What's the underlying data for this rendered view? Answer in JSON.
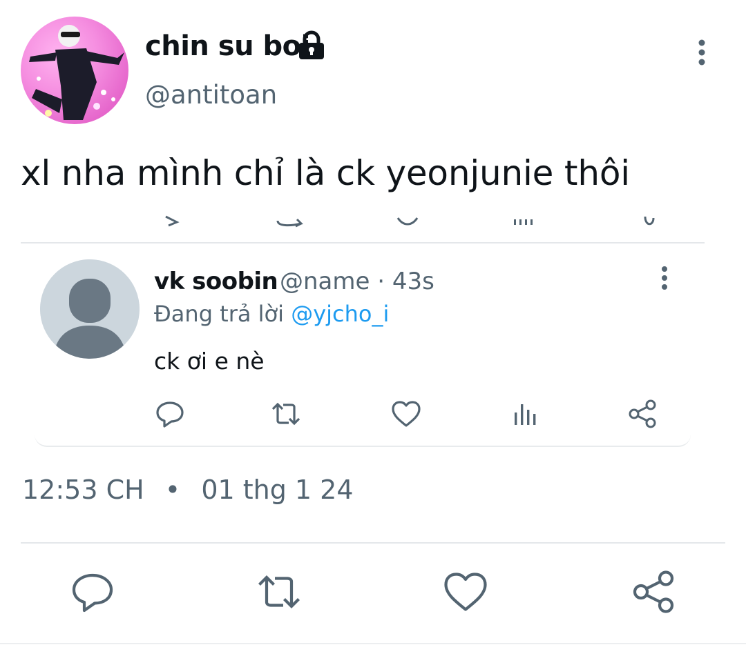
{
  "author": {
    "display_name": "chin su boi",
    "handle": "@antitoan",
    "protected": true,
    "avatar": "anime-character-avatar"
  },
  "tweet": {
    "text": "xl nha mình chỉ là ck yeonjunie thôi",
    "time": "12:53 CH",
    "separator": "•",
    "date": "01 thg 1 24"
  },
  "quoted": {
    "display_name": "vk soobin",
    "handle": "@name",
    "age": "43s",
    "meta": "@name · 43s",
    "reply_prefix": "Đang trả lời",
    "reply_to": "@yjcho_i",
    "text": "ck ơi e nè",
    "avatar": "default-avatar"
  },
  "icons": {
    "reply": "reply-icon",
    "retweet": "retweet-icon",
    "like": "heart-icon",
    "views": "analytics-icon",
    "share": "share-icon",
    "more": "more-vertical-icon",
    "lock": "lock-icon"
  },
  "colors": {
    "text": "#0f1419",
    "secondary": "#536471",
    "link": "#1d9bf0",
    "divider": "#e4e7ea"
  }
}
